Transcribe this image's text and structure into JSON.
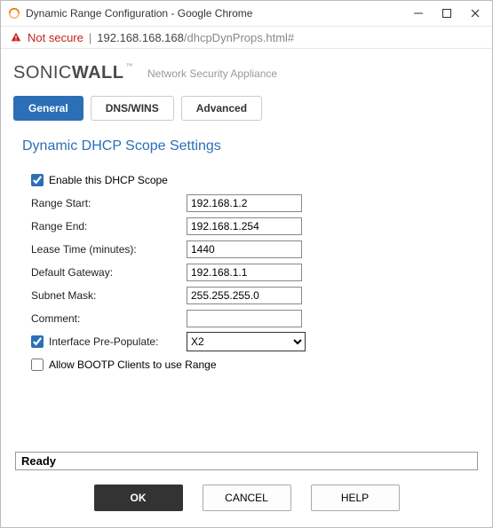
{
  "window": {
    "title": "Dynamic Range Configuration - Google Chrome"
  },
  "addressbar": {
    "not_secure": "Not secure",
    "host": "192.168.168.168",
    "path": "/dhcpDynProps.html#"
  },
  "brand": {
    "part1": "SONIC",
    "part2": "WALL",
    "tm": "™",
    "subtitle": "Network Security Appliance"
  },
  "tabs": {
    "general": "General",
    "dnswins": "DNS/WINS",
    "advanced": "Advanced"
  },
  "section_title": "Dynamic DHCP Scope Settings",
  "form": {
    "enable_label": "Enable this DHCP Scope",
    "enable_checked": true,
    "range_start_label": "Range Start:",
    "range_start": "192.168.1.2",
    "range_end_label": "Range End:",
    "range_end": "192.168.1.254",
    "lease_label": "Lease Time (minutes):",
    "lease": "1440",
    "gateway_label": "Default Gateway:",
    "gateway": "192.168.1.1",
    "mask_label": "Subnet Mask:",
    "mask": "255.255.255.0",
    "comment_label": "Comment:",
    "comment": "",
    "prepop_label": "Interface Pre-Populate:",
    "prepop_checked": true,
    "prepop_value": "X2",
    "bootp_label": "Allow BOOTP Clients to use Range",
    "bootp_checked": false
  },
  "status": "Ready",
  "buttons": {
    "ok": "OK",
    "cancel": "CANCEL",
    "help": "HELP"
  }
}
